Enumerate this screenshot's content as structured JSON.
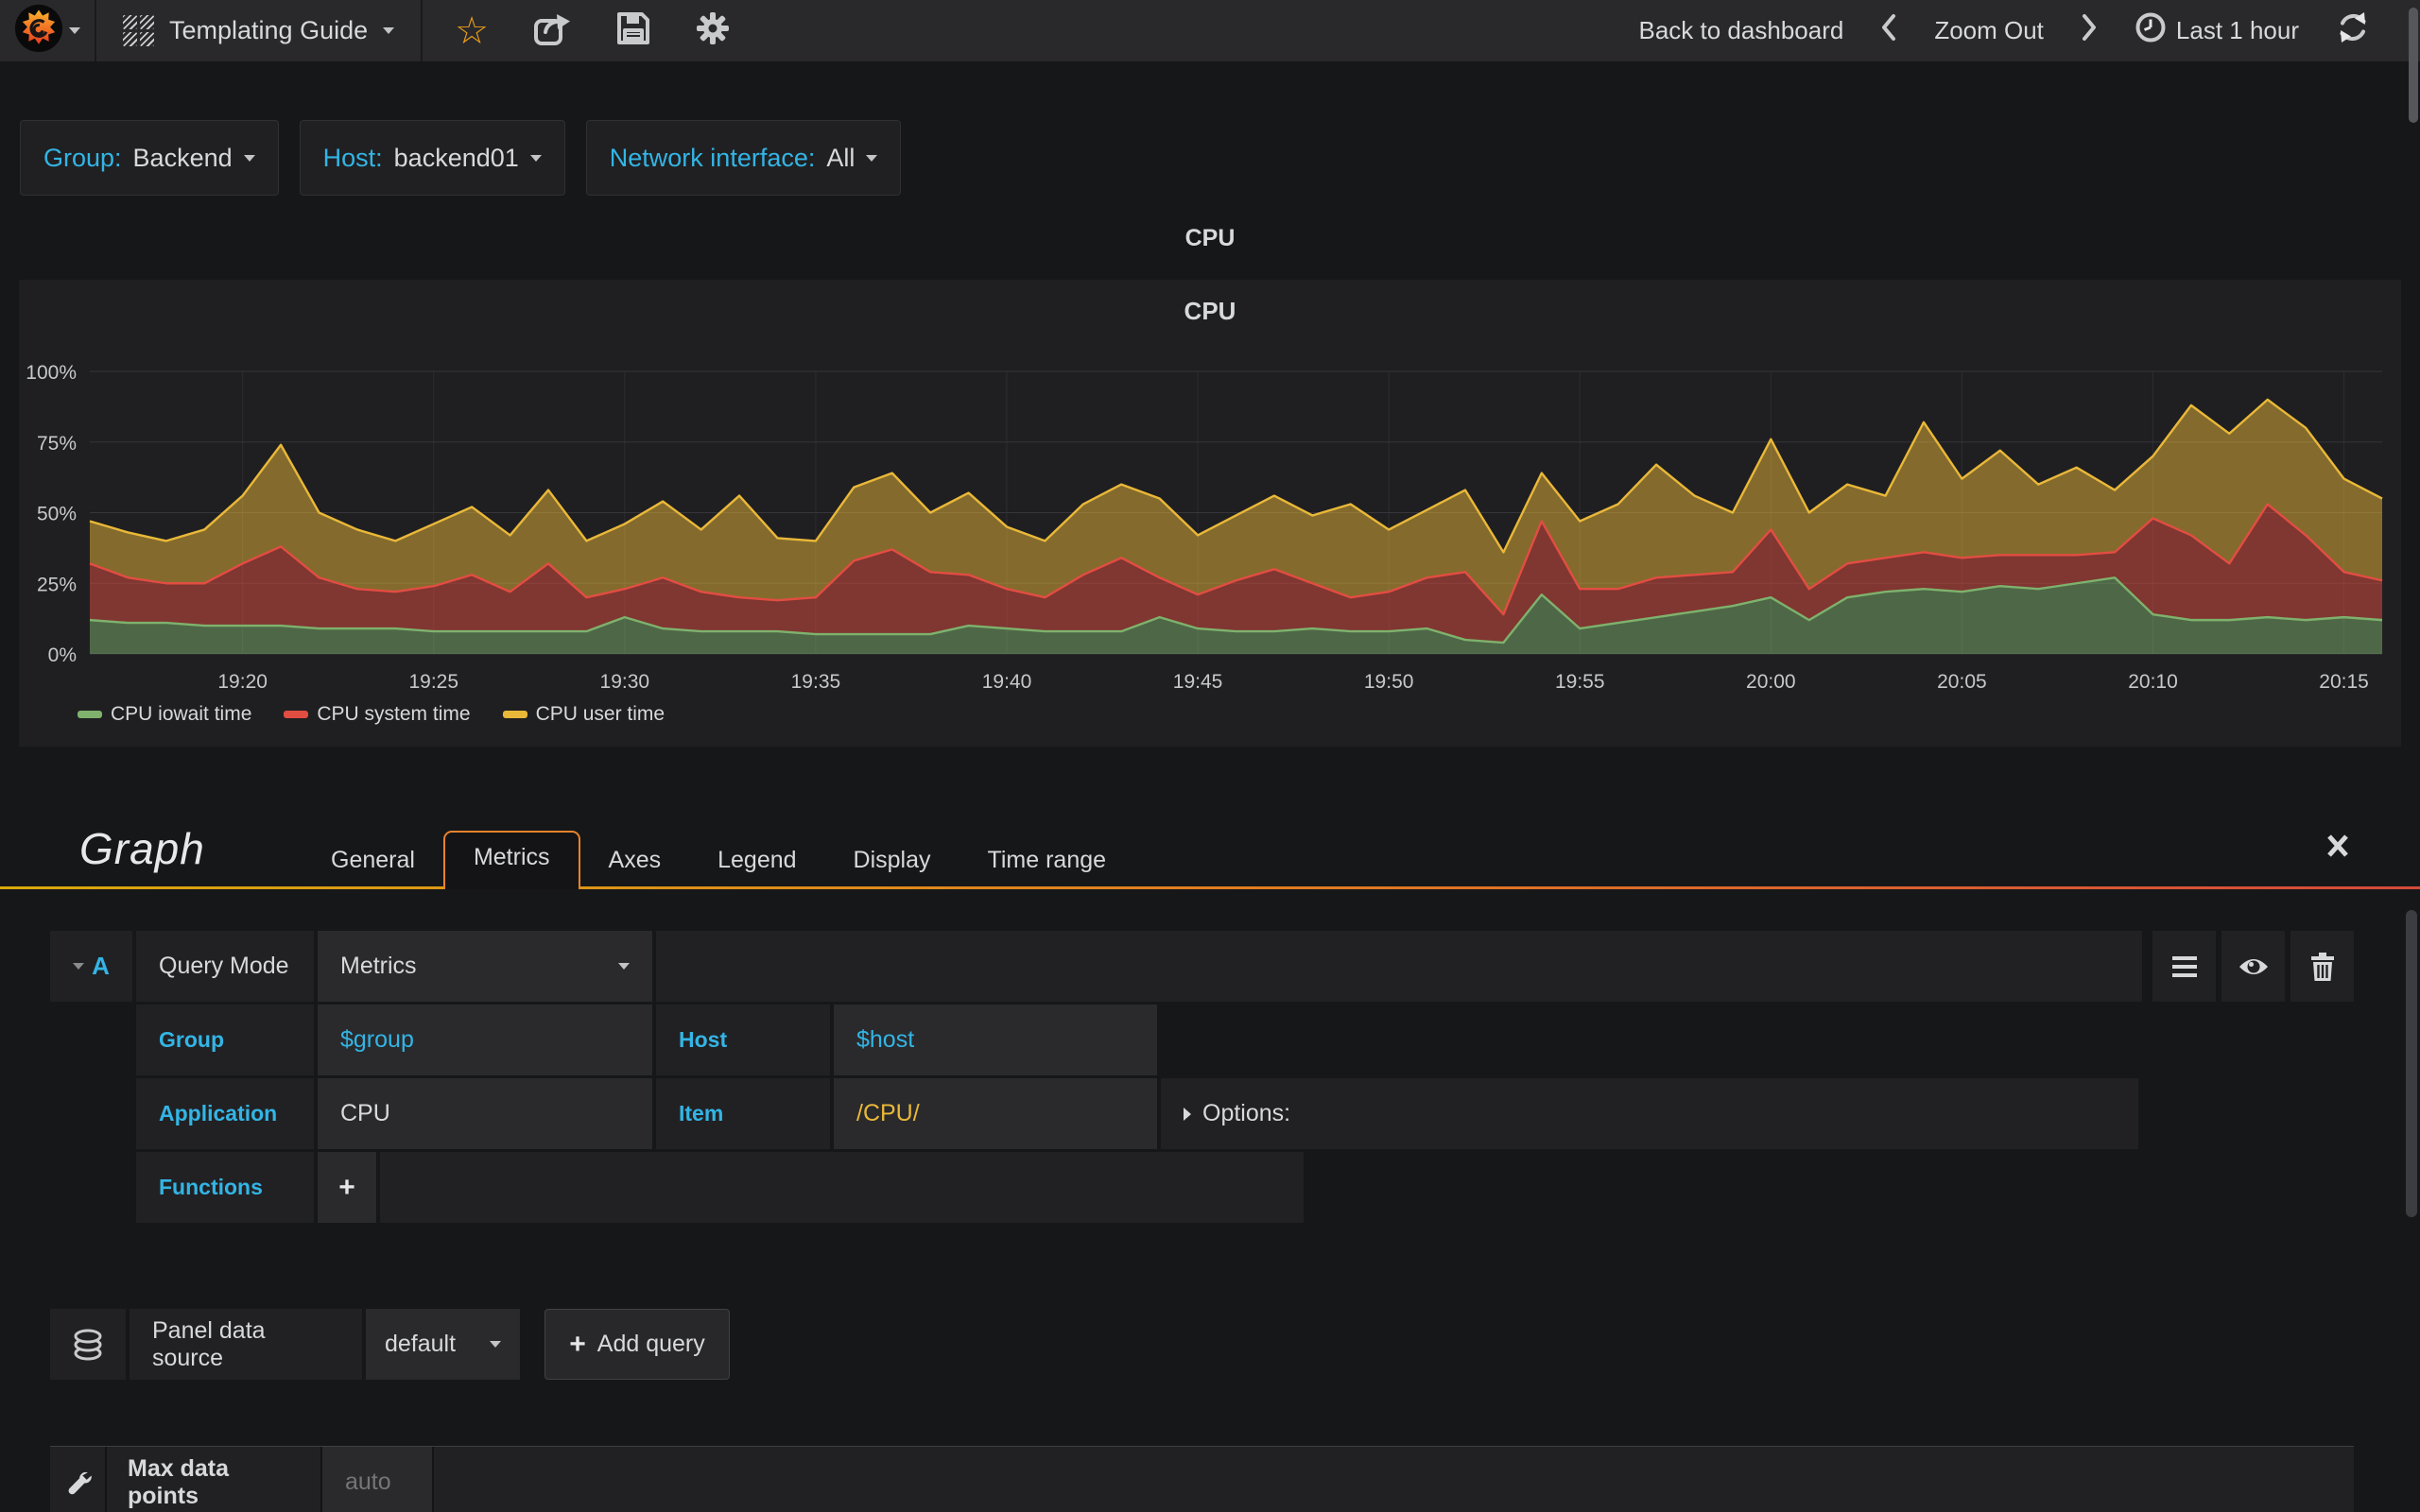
{
  "navbar": {
    "title": "Templating Guide",
    "actions": {
      "back_to_dashboard": "Back to dashboard",
      "zoom_out": "Zoom Out",
      "time_range": "Last 1 hour"
    },
    "icons": [
      "grafana-logo",
      "dashboard-grid",
      "star",
      "share",
      "save",
      "gear",
      "chevron-left",
      "chevron-right",
      "clock",
      "refresh"
    ]
  },
  "variables": [
    {
      "label": "Group:",
      "value": "Backend"
    },
    {
      "label": "Host:",
      "value": "backend01"
    },
    {
      "label": "Network interface:",
      "value": "All"
    }
  ],
  "panel": {
    "header_title": "CPU",
    "graph_title": "CPU"
  },
  "chart_data": {
    "type": "area",
    "stacked": true,
    "title": "CPU",
    "xlabel": "",
    "ylabel": "",
    "ylim": [
      0,
      100
    ],
    "grid": true,
    "legend_position": "bottom",
    "y_ticks": [
      "0%",
      "25%",
      "50%",
      "75%",
      "100%"
    ],
    "x_ticks": [
      "19:20",
      "19:25",
      "19:30",
      "19:35",
      "19:40",
      "19:45",
      "19:50",
      "19:55",
      "20:00",
      "20:05",
      "20:10",
      "20:15"
    ],
    "x_start": "19:16",
    "x_end": "20:16",
    "step_minutes": 1,
    "series": [
      {
        "name": "CPU iowait time",
        "color": "#7EB26D",
        "values": [
          12,
          11,
          11,
          10,
          10,
          10,
          9,
          9,
          9,
          8,
          8,
          8,
          8,
          8,
          13,
          9,
          8,
          8,
          8,
          7,
          7,
          7,
          7,
          10,
          9,
          8,
          8,
          8,
          13,
          9,
          8,
          8,
          9,
          8,
          8,
          9,
          5,
          4,
          21,
          9,
          11,
          13,
          15,
          17,
          20,
          12,
          20,
          22,
          23,
          22,
          24,
          23,
          25,
          27,
          14,
          12,
          12,
          13,
          12,
          13,
          12
        ]
      },
      {
        "name": "CPU system time",
        "color": "#E24D42",
        "values": [
          20,
          16,
          14,
          15,
          22,
          28,
          18,
          14,
          13,
          16,
          20,
          14,
          24,
          12,
          10,
          18,
          14,
          12,
          11,
          13,
          26,
          30,
          22,
          18,
          14,
          12,
          20,
          26,
          14,
          12,
          18,
          22,
          16,
          12,
          14,
          18,
          24,
          10,
          26,
          14,
          12,
          14,
          13,
          12,
          24,
          11,
          12,
          12,
          13,
          12,
          11,
          12,
          10,
          9,
          34,
          30,
          20,
          40,
          30,
          16,
          14
        ]
      },
      {
        "name": "CPU user time",
        "color": "#EAB839",
        "values": [
          15,
          16,
          15,
          19,
          24,
          36,
          23,
          21,
          18,
          22,
          24,
          20,
          26,
          20,
          23,
          27,
          22,
          36,
          22,
          20,
          26,
          27,
          21,
          29,
          22,
          20,
          25,
          26,
          28,
          21,
          23,
          26,
          24,
          33,
          22,
          24,
          29,
          22,
          17,
          24,
          30,
          40,
          28,
          21,
          32,
          27,
          28,
          22,
          46,
          28,
          37,
          25,
          31,
          22,
          22,
          46,
          46,
          37,
          38,
          33,
          29
        ]
      }
    ]
  },
  "editor": {
    "title": "Graph",
    "active_tab": "Metrics",
    "tabs": [
      {
        "label": "General"
      },
      {
        "label": "Metrics"
      },
      {
        "label": "Axes"
      },
      {
        "label": "Legend"
      },
      {
        "label": "Display"
      },
      {
        "label": "Time range"
      }
    ],
    "query": {
      "ref": "A",
      "mode_label": "Query Mode",
      "mode_value": "Metrics",
      "group_label": "Group",
      "group_value": "$group",
      "host_label": "Host",
      "host_value": "$host",
      "application_label": "Application",
      "application_value": "CPU",
      "item_label": "Item",
      "item_value": "/CPU/",
      "options_label": "Options:",
      "functions_label": "Functions",
      "add_function_label": "+"
    },
    "datasource": {
      "label": "Panel data source",
      "value": "default",
      "add_query_label": "Add query"
    },
    "max_data_points": {
      "label": "Max data points",
      "placeholder": "auto"
    }
  }
}
